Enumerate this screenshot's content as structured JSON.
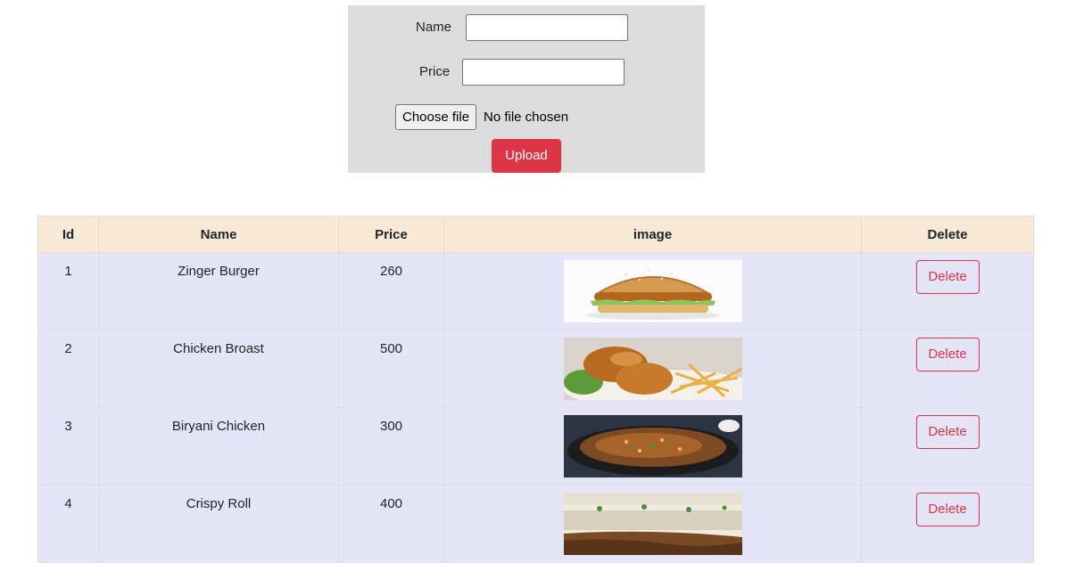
{
  "form": {
    "name_label": "Name",
    "name_value": "",
    "price_label": "Price",
    "price_value": "",
    "file_button_label": "Choose file",
    "file_status": "No file chosen",
    "upload_label": "Upload"
  },
  "table": {
    "headers": [
      "Id",
      "Name",
      "Price",
      "image",
      "Delete"
    ],
    "delete_label": "Delete",
    "rows": [
      {
        "id": "1",
        "name": "Zinger Burger",
        "price": "260",
        "image": "burger-image"
      },
      {
        "id": "2",
        "name": "Chicken Broast",
        "price": "500",
        "image": "fried-chicken-image"
      },
      {
        "id": "3",
        "name": "Biryani Chicken",
        "price": "300",
        "image": "biryani-image"
      },
      {
        "id": "4",
        "name": "Crispy Roll",
        "price": "400",
        "image": "roll-image"
      }
    ]
  },
  "colors": {
    "danger": "#dc3545",
    "form_bg": "#dcdcdc",
    "header_bg": "#f9ead8",
    "row_bg": "#e5e5f7"
  }
}
